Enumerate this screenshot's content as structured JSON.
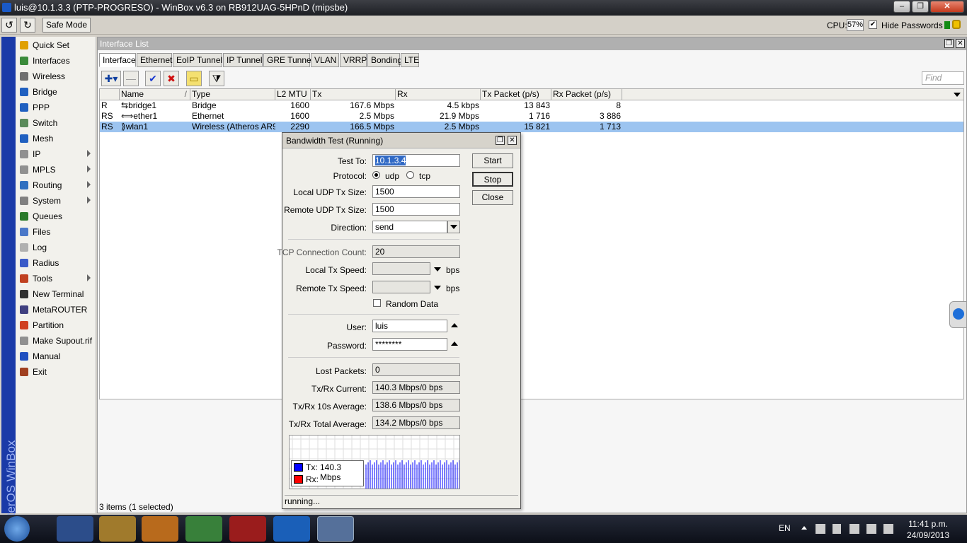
{
  "window": {
    "title": "luis@10.1.3.3 (PTP-PROGRESO) - WinBox v6.3 on RB912UAG-5HPnD (mipsbe)",
    "min": "‒",
    "max": "❐",
    "close": "✕"
  },
  "toolbar": {
    "undo": "↺",
    "redo": "↻",
    "safe_mode": "Safe Mode",
    "cpu_label": "CPU:",
    "cpu_value": "57%",
    "hide_passwords_checked": "✔",
    "hide_passwords": "Hide Passwords"
  },
  "vbar_text": "RouterOS WinBox",
  "sidebar": {
    "items": [
      {
        "label": "Quick Set",
        "icon": "quick-set-icon",
        "color": "#e0a000",
        "sub": false
      },
      {
        "label": "Interfaces",
        "icon": "interfaces-icon",
        "color": "#3a8a3a",
        "sub": false
      },
      {
        "label": "Wireless",
        "icon": "wireless-icon",
        "color": "#707070",
        "sub": false
      },
      {
        "label": "Bridge",
        "icon": "bridge-icon",
        "color": "#2060c0",
        "sub": false
      },
      {
        "label": "PPP",
        "icon": "ppp-icon",
        "color": "#2060c0",
        "sub": false
      },
      {
        "label": "Switch",
        "icon": "switch-icon",
        "color": "#5a8a5a",
        "sub": false
      },
      {
        "label": "Mesh",
        "icon": "mesh-icon",
        "color": "#2060c0",
        "sub": false
      },
      {
        "label": "IP",
        "icon": "ip-icon",
        "color": "#909090",
        "sub": true
      },
      {
        "label": "MPLS",
        "icon": "mpls-icon",
        "color": "#909090",
        "sub": true
      },
      {
        "label": "Routing",
        "icon": "routing-icon",
        "color": "#3070c0",
        "sub": true
      },
      {
        "label": "System",
        "icon": "system-icon",
        "color": "#808080",
        "sub": true
      },
      {
        "label": "Queues",
        "icon": "queues-icon",
        "color": "#2a7a2a",
        "sub": false
      },
      {
        "label": "Files",
        "icon": "files-icon",
        "color": "#4a78c8",
        "sub": false
      },
      {
        "label": "Log",
        "icon": "log-icon",
        "color": "#b0b0b0",
        "sub": false
      },
      {
        "label": "Radius",
        "icon": "radius-icon",
        "color": "#3a5ac8",
        "sub": false
      },
      {
        "label": "Tools",
        "icon": "tools-icon",
        "color": "#c04020",
        "sub": true
      },
      {
        "label": "New Terminal",
        "icon": "terminal-icon",
        "color": "#303030",
        "sub": false
      },
      {
        "label": "MetaROUTER",
        "icon": "metarouter-icon",
        "color": "#404080",
        "sub": false
      },
      {
        "label": "Partition",
        "icon": "partition-icon",
        "color": "#d04020",
        "sub": false
      },
      {
        "label": "Make Supout.rif",
        "icon": "supout-icon",
        "color": "#909090",
        "sub": false
      },
      {
        "label": "Manual",
        "icon": "manual-icon",
        "color": "#2050c0",
        "sub": false
      },
      {
        "label": "Exit",
        "icon": "exit-icon",
        "color": "#a04020",
        "sub": false
      }
    ]
  },
  "interface_list": {
    "title": "Interface List",
    "restore": "❐",
    "close": "✕",
    "tabs": [
      "Interface",
      "Ethernet",
      "EoIP Tunnel",
      "IP Tunnel",
      "GRE Tunnel",
      "VLAN",
      "VRRP",
      "Bonding",
      "LTE"
    ],
    "buttons": {
      "add": "✚▾",
      "remove": "—",
      "enable": "✔",
      "disable": "✖",
      "comment": "▭",
      "filter": "⧩"
    },
    "find_placeholder": "Find",
    "columns": [
      "",
      "Name",
      "Type",
      "L2 MTU",
      "Tx",
      "Rx",
      "Tx Packet (p/s)",
      "Rx Packet (p/s)"
    ],
    "sort_indicator": "/",
    "rows": [
      {
        "flag": "R",
        "name": "bridge1",
        "icon": "⇆",
        "type": "Bridge",
        "l2mtu": "1600",
        "tx": "167.6 Mbps",
        "rx": "4.5 kbps",
        "txp": "13 843",
        "rxp": "8",
        "selected": false
      },
      {
        "flag": "RS",
        "name": "ether1",
        "icon": "⟺",
        "type": "Ethernet",
        "l2mtu": "1600",
        "tx": "2.5 Mbps",
        "rx": "21.9 Mbps",
        "txp": "1 716",
        "rxp": "3 886",
        "selected": false
      },
      {
        "flag": "RS",
        "name": "wlan1",
        "icon": "⟫",
        "type": "Wireless (Atheros AR9...",
        "l2mtu": "2290",
        "tx": "166.5 Mbps",
        "rx": "2.5 Mbps",
        "txp": "15 821",
        "rxp": "1 713",
        "selected": true
      }
    ],
    "status": "3 items (1 selected)"
  },
  "bandwidth_test": {
    "title": "Bandwidth Test (Running)",
    "restore": "❐",
    "close": "✕",
    "test_to_label": "Test To:",
    "test_to": "10.1.3.4",
    "protocol_label": "Protocol:",
    "protocol_udp": "udp",
    "protocol_tcp": "tcp",
    "local_udp_label": "Local UDP Tx Size:",
    "local_udp": "1500",
    "remote_udp_label": "Remote UDP Tx Size:",
    "remote_udp": "1500",
    "direction_label": "Direction:",
    "direction": "send",
    "tcp_count_label": "TCP Connection Count:",
    "tcp_count": "20",
    "local_speed_label": "Local Tx Speed:",
    "remote_speed_label": "Remote Tx Speed:",
    "bps": "bps",
    "random_data": "Random Data",
    "user_label": "User:",
    "user": "luis",
    "password_label": "Password:",
    "password": "********",
    "lost_label": "Lost Packets:",
    "lost": "0",
    "current_label": "Tx/Rx Current:",
    "current": "140.3 Mbps/0 bps",
    "avg10_label": "Tx/Rx 10s Average:",
    "avg10": "138.6 Mbps/0 bps",
    "total_label": "Tx/Rx Total Average:",
    "total": "134.2 Mbps/0 bps",
    "start": "Start",
    "stop": "Stop",
    "close_btn": "Close",
    "legend_tx": "Tx:",
    "legend_tx_value": "140.3 Mbps",
    "legend_rx": "Rx:",
    "tx_color": "#0000ff",
    "rx_color": "#ff0000",
    "status": "running..."
  },
  "taskbar": {
    "lang": "EN",
    "time": "11:41 p.m.",
    "date": "24/09/2013"
  }
}
